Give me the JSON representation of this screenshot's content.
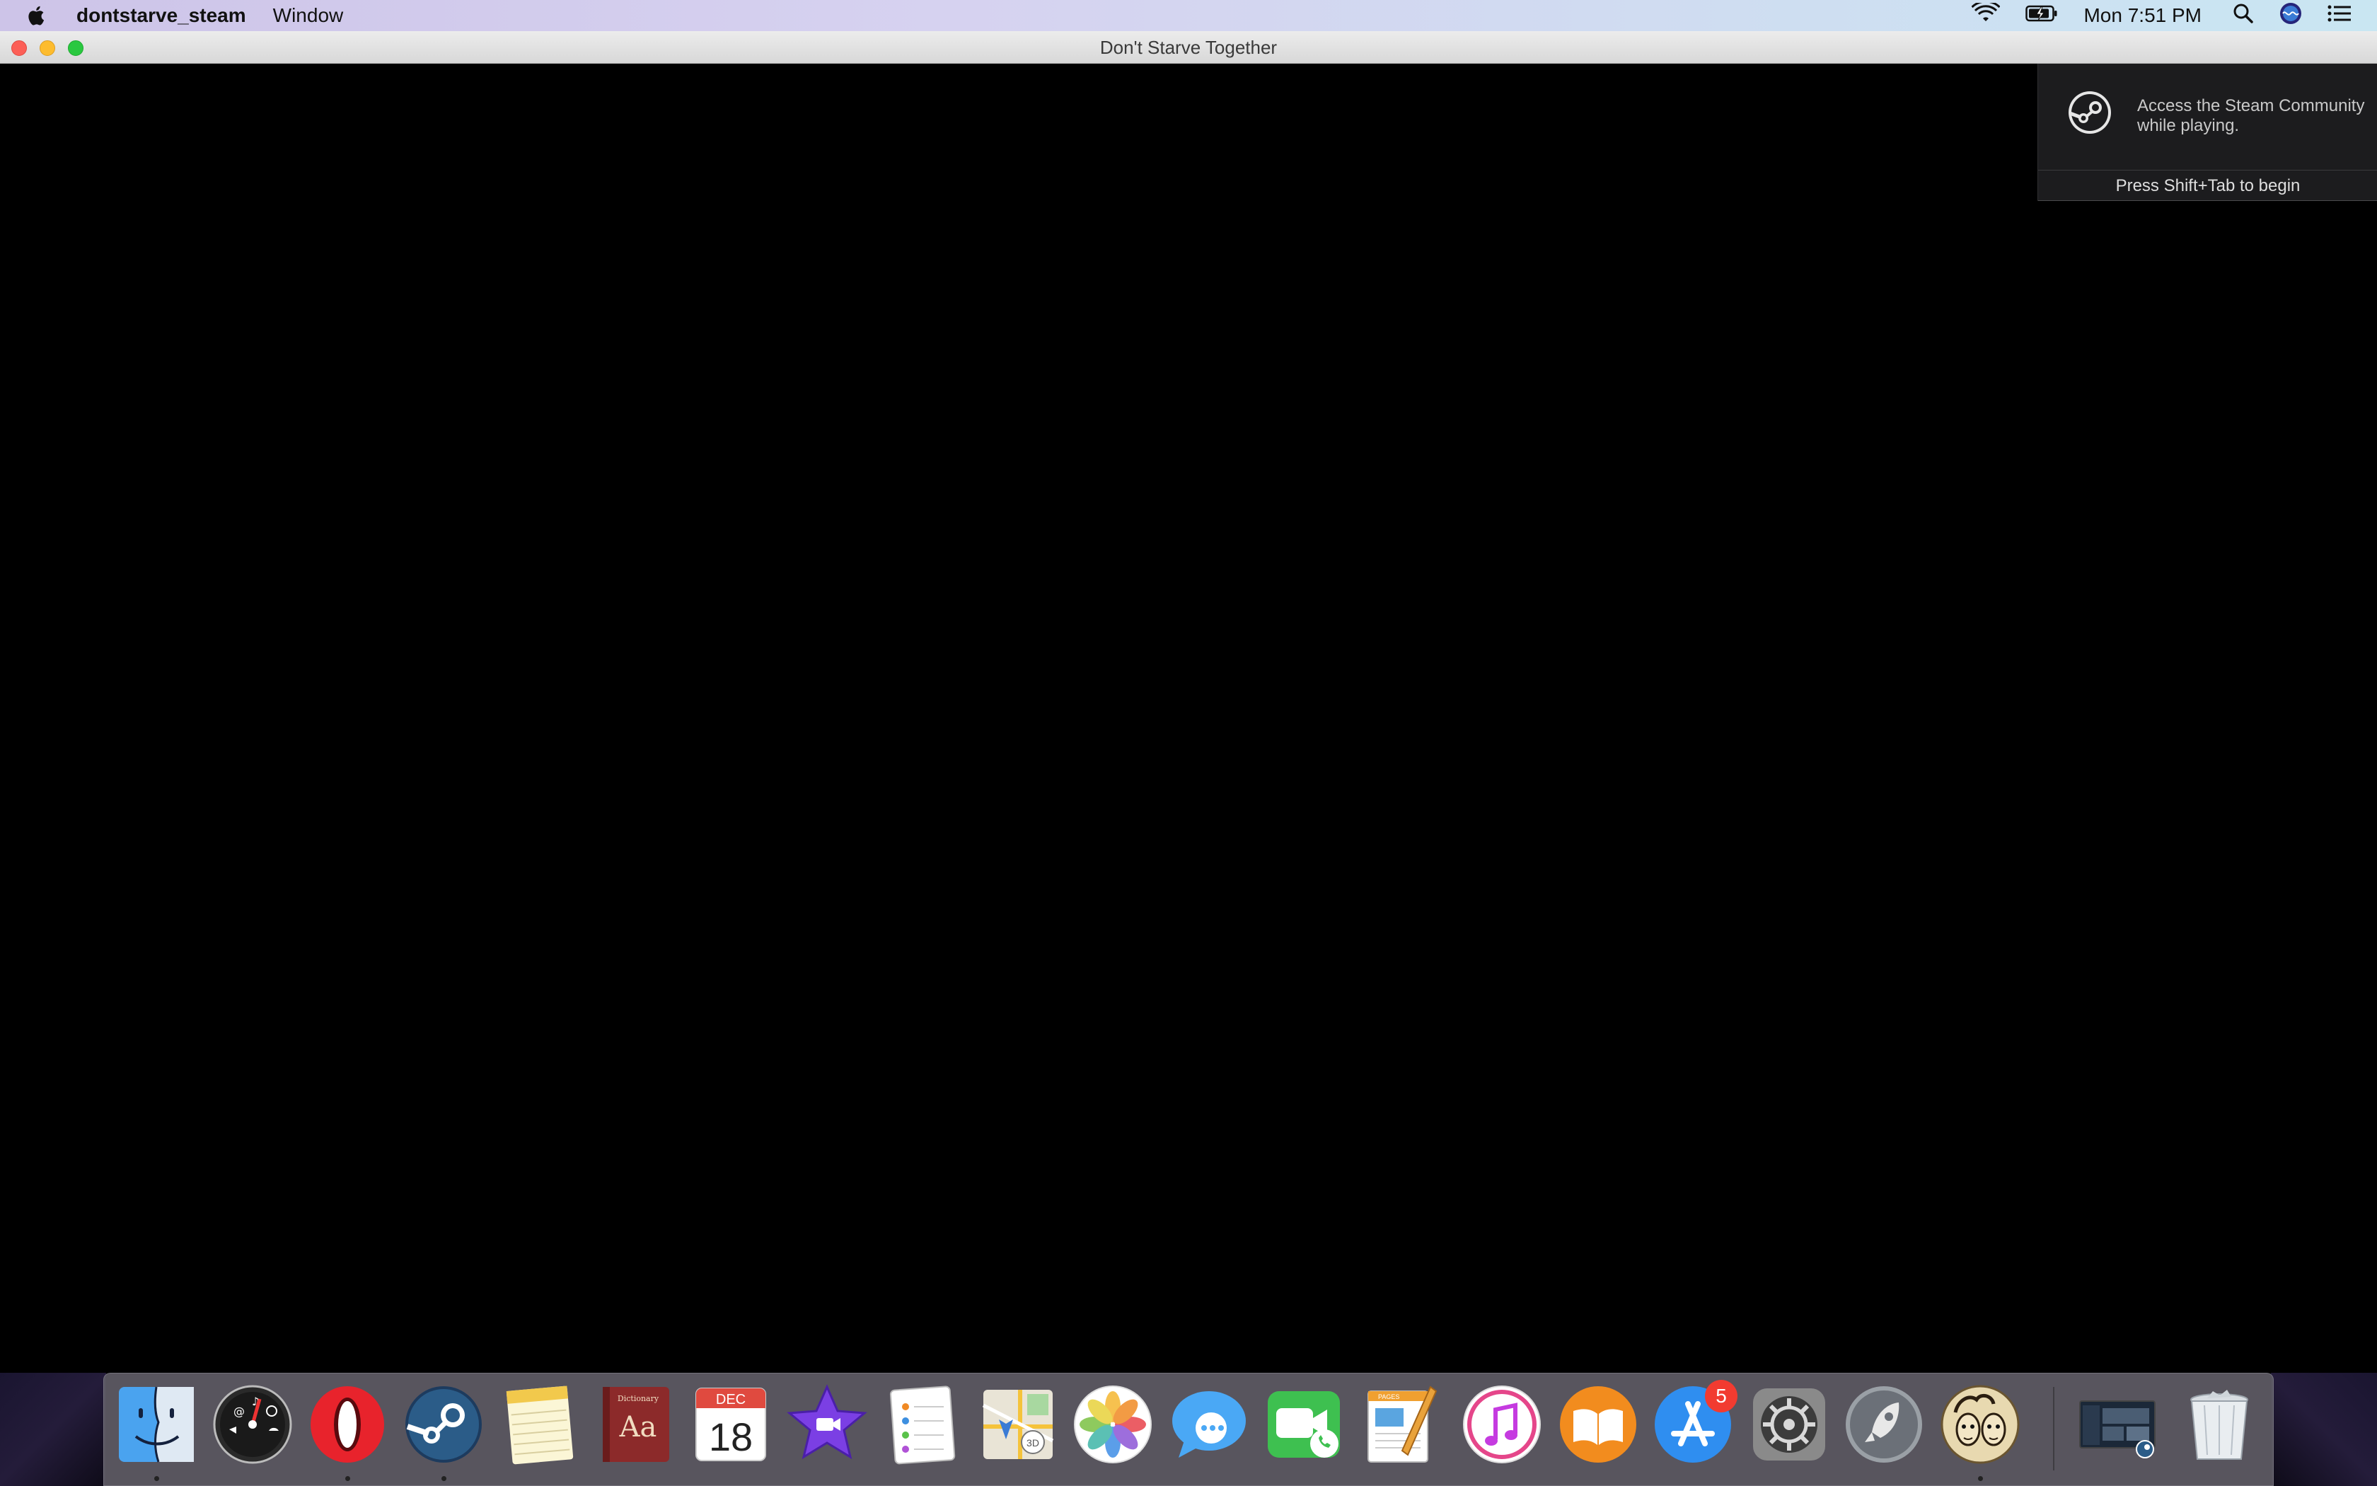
{
  "menubar": {
    "app_name": "dontstarve_steam",
    "menu_window": "Window",
    "clock": "Mon 7:51 PM",
    "icons": [
      "apple-icon",
      "wifi-icon",
      "battery-icon",
      "spotlight-search-icon",
      "siri-icon",
      "notification-center-icon"
    ]
  },
  "window": {
    "title": "Don't Starve Together"
  },
  "steam_overlay": {
    "message": "Access the Steam Community while playing.",
    "hint": "Press Shift+Tab to begin"
  },
  "dock": {
    "apps": [
      {
        "name": "Finder",
        "icon": "finder-icon",
        "running": true
      },
      {
        "name": "Dashboard",
        "icon": "dashboard-icon",
        "running": false
      },
      {
        "name": "Opera",
        "icon": "opera-icon",
        "running": true
      },
      {
        "name": "Steam",
        "icon": "steam-icon",
        "running": true
      },
      {
        "name": "Notes",
        "icon": "notes-icon",
        "running": false
      },
      {
        "name": "Dictionary",
        "icon": "dictionary-icon",
        "running": false
      },
      {
        "name": "Calendar",
        "icon": "calendar-icon",
        "running": false
      },
      {
        "name": "iMovie",
        "icon": "imovie-icon",
        "running": false
      },
      {
        "name": "Reminders",
        "icon": "reminders-icon",
        "running": false
      },
      {
        "name": "Maps",
        "icon": "maps-icon",
        "running": false
      },
      {
        "name": "Photos",
        "icon": "photos-icon",
        "running": false
      },
      {
        "name": "Messages",
        "icon": "messages-icon",
        "running": false
      },
      {
        "name": "FaceTime",
        "icon": "facetime-icon",
        "running": false
      },
      {
        "name": "Pages",
        "icon": "pages-icon",
        "running": false
      },
      {
        "name": "iTunes",
        "icon": "itunes-icon",
        "running": false
      },
      {
        "name": "iBooks",
        "icon": "ibooks-icon",
        "running": false
      },
      {
        "name": "App Store",
        "icon": "app-store-icon",
        "running": false
      },
      {
        "name": "System Preferences",
        "icon": "system-preferences-icon",
        "running": false
      },
      {
        "name": "Launchpad",
        "icon": "launchpad-icon",
        "running": false
      },
      {
        "name": "Don't Starve Together",
        "icon": "dont-starve-together-icon",
        "running": true
      },
      {
        "name": "Steam Window",
        "icon": "minimized-window-icon",
        "running": false
      },
      {
        "name": "Trash",
        "icon": "trash-icon",
        "running": false
      }
    ],
    "app_store_badge": "5",
    "calendar_month": "DEC",
    "calendar_day": "18",
    "dictionary_label": "Aa",
    "dictionary_title": "Dictionary",
    "pages_label": "PAGES",
    "maps_label": "3D"
  },
  "colors": {
    "badge": "#f23b30",
    "steam_overlay_bg": "#1c1c1e"
  }
}
